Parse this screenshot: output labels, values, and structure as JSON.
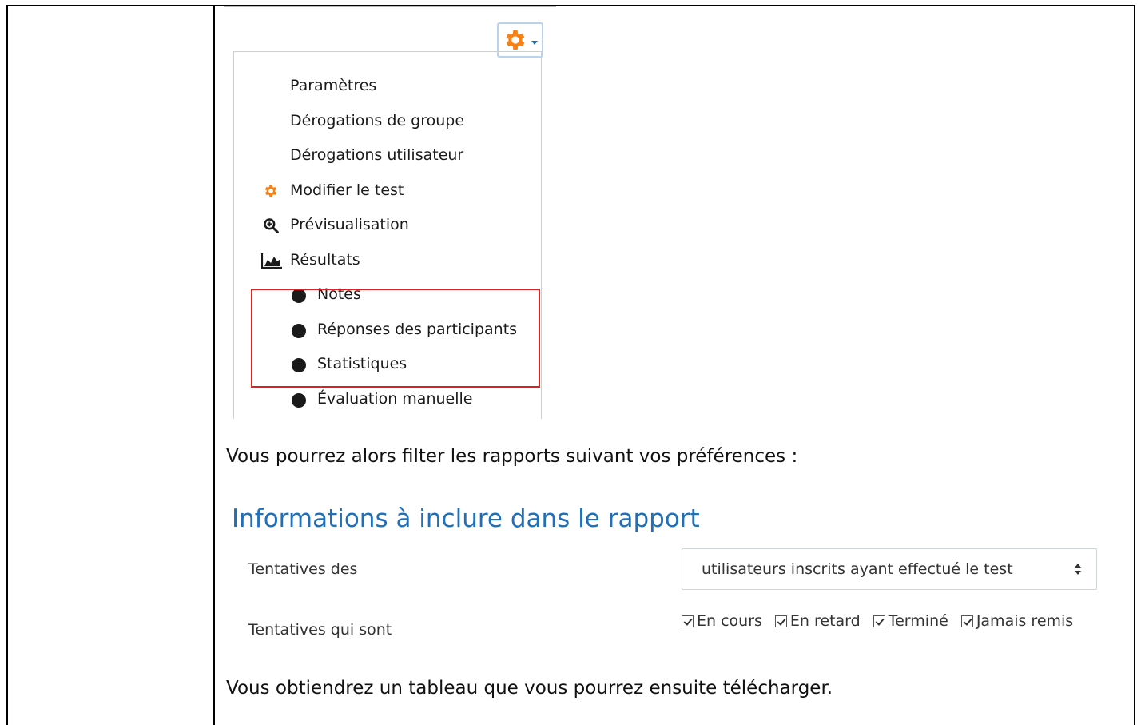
{
  "menu": {
    "items": [
      {
        "label": "Paramètres",
        "icon": "none",
        "indent": false
      },
      {
        "label": "Dérogations de groupe",
        "icon": "none",
        "indent": false
      },
      {
        "label": "Dérogations utilisateur",
        "icon": "none",
        "indent": false
      },
      {
        "label": "Modifier le test",
        "icon": "gear-icon",
        "indent": false
      },
      {
        "label": "Prévisualisation",
        "icon": "zoom-in-icon",
        "indent": false
      },
      {
        "label": "Résultats",
        "icon": "area-chart-icon",
        "indent": false
      },
      {
        "label": "Notes",
        "icon": "bullet-icon",
        "indent": true
      },
      {
        "label": "Réponses des participants",
        "icon": "bullet-icon",
        "indent": true
      },
      {
        "label": "Statistiques",
        "icon": "bullet-icon",
        "indent": true
      },
      {
        "label": "Évaluation manuelle",
        "icon": "bullet-icon",
        "indent": true
      }
    ]
  },
  "doc": {
    "para1": "Vous pourrez alors filter les rapports suivant vos préférences :",
    "para2": "Vous obtiendrez un tableau que vous pourrez ensuite télécharger."
  },
  "report": {
    "heading": "Informations à inclure dans le rapport",
    "attempts_from_label": "Tentatives des",
    "attempts_from_value": "utilisateurs inscrits ayant effectué le test",
    "attempts_state_label": "Tentatives qui sont",
    "states": [
      "En cours",
      "En retard",
      "Terminé",
      "Jamais remis"
    ]
  },
  "colors": {
    "accent": "#1f70b8",
    "gear": "#f98012",
    "highlight": "#e02020"
  }
}
